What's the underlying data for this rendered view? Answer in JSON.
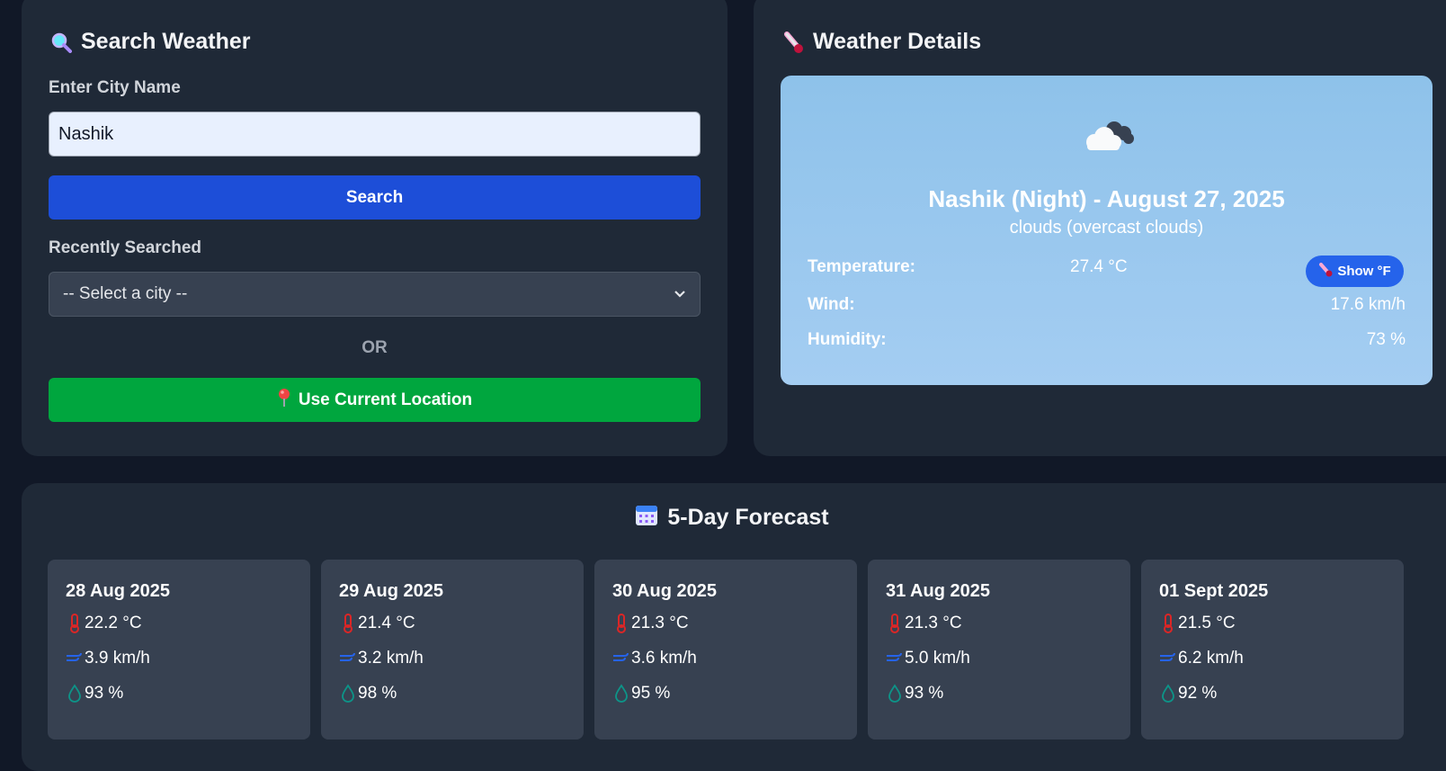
{
  "search": {
    "title": "Search Weather",
    "city_label": "Enter City Name",
    "city_value": "Nashik",
    "search_button": "Search",
    "recent_label": "Recently Searched",
    "select_value": "-- Select a city --",
    "or_text": "OR",
    "location_button": "Use Current Location"
  },
  "details": {
    "title": "Weather Details",
    "heading": "Nashik (Night) - August 27, 2025",
    "description": "clouds (overcast clouds)",
    "temperature_label": "Temperature:",
    "temperature_value": "27.4 °C",
    "show_f_button": "Show °F",
    "wind_label": "Wind:",
    "wind_value": "17.6 km/h",
    "humidity_label": "Humidity:",
    "humidity_value": "73 %"
  },
  "forecast": {
    "title": "5-Day Forecast",
    "days": [
      {
        "date": "28 Aug 2025",
        "temp": "22.2 °C",
        "wind": "3.9 km/h",
        "humidity": "93 %"
      },
      {
        "date": "29 Aug 2025",
        "temp": "21.4 °C",
        "wind": "3.2 km/h",
        "humidity": "98 %"
      },
      {
        "date": "30 Aug 2025",
        "temp": "21.3 °C",
        "wind": "3.6 km/h",
        "humidity": "95 %"
      },
      {
        "date": "31 Aug 2025",
        "temp": "21.3 °C",
        "wind": "5.0 km/h",
        "humidity": "93 %"
      },
      {
        "date": "01 Sept 2025",
        "temp": "21.5 °C",
        "wind": "6.2 km/h",
        "humidity": "92 %"
      }
    ]
  },
  "icons": {
    "search_title": "magnifier-icon",
    "details_title": "thermometer-icon",
    "forecast_title": "calendar-icon",
    "location": "pin-icon",
    "weather": "cloud-icon",
    "temp": "thermometer-icon",
    "wind": "wind-icon",
    "humidity": "droplet-icon"
  },
  "colors": {
    "page_bg": "#111827",
    "panel_bg": "#1f2937",
    "search_button": "#1d4ed8",
    "location_button": "#00a63e",
    "show_f_button": "#2563eb",
    "forecast_card": "#374151"
  }
}
